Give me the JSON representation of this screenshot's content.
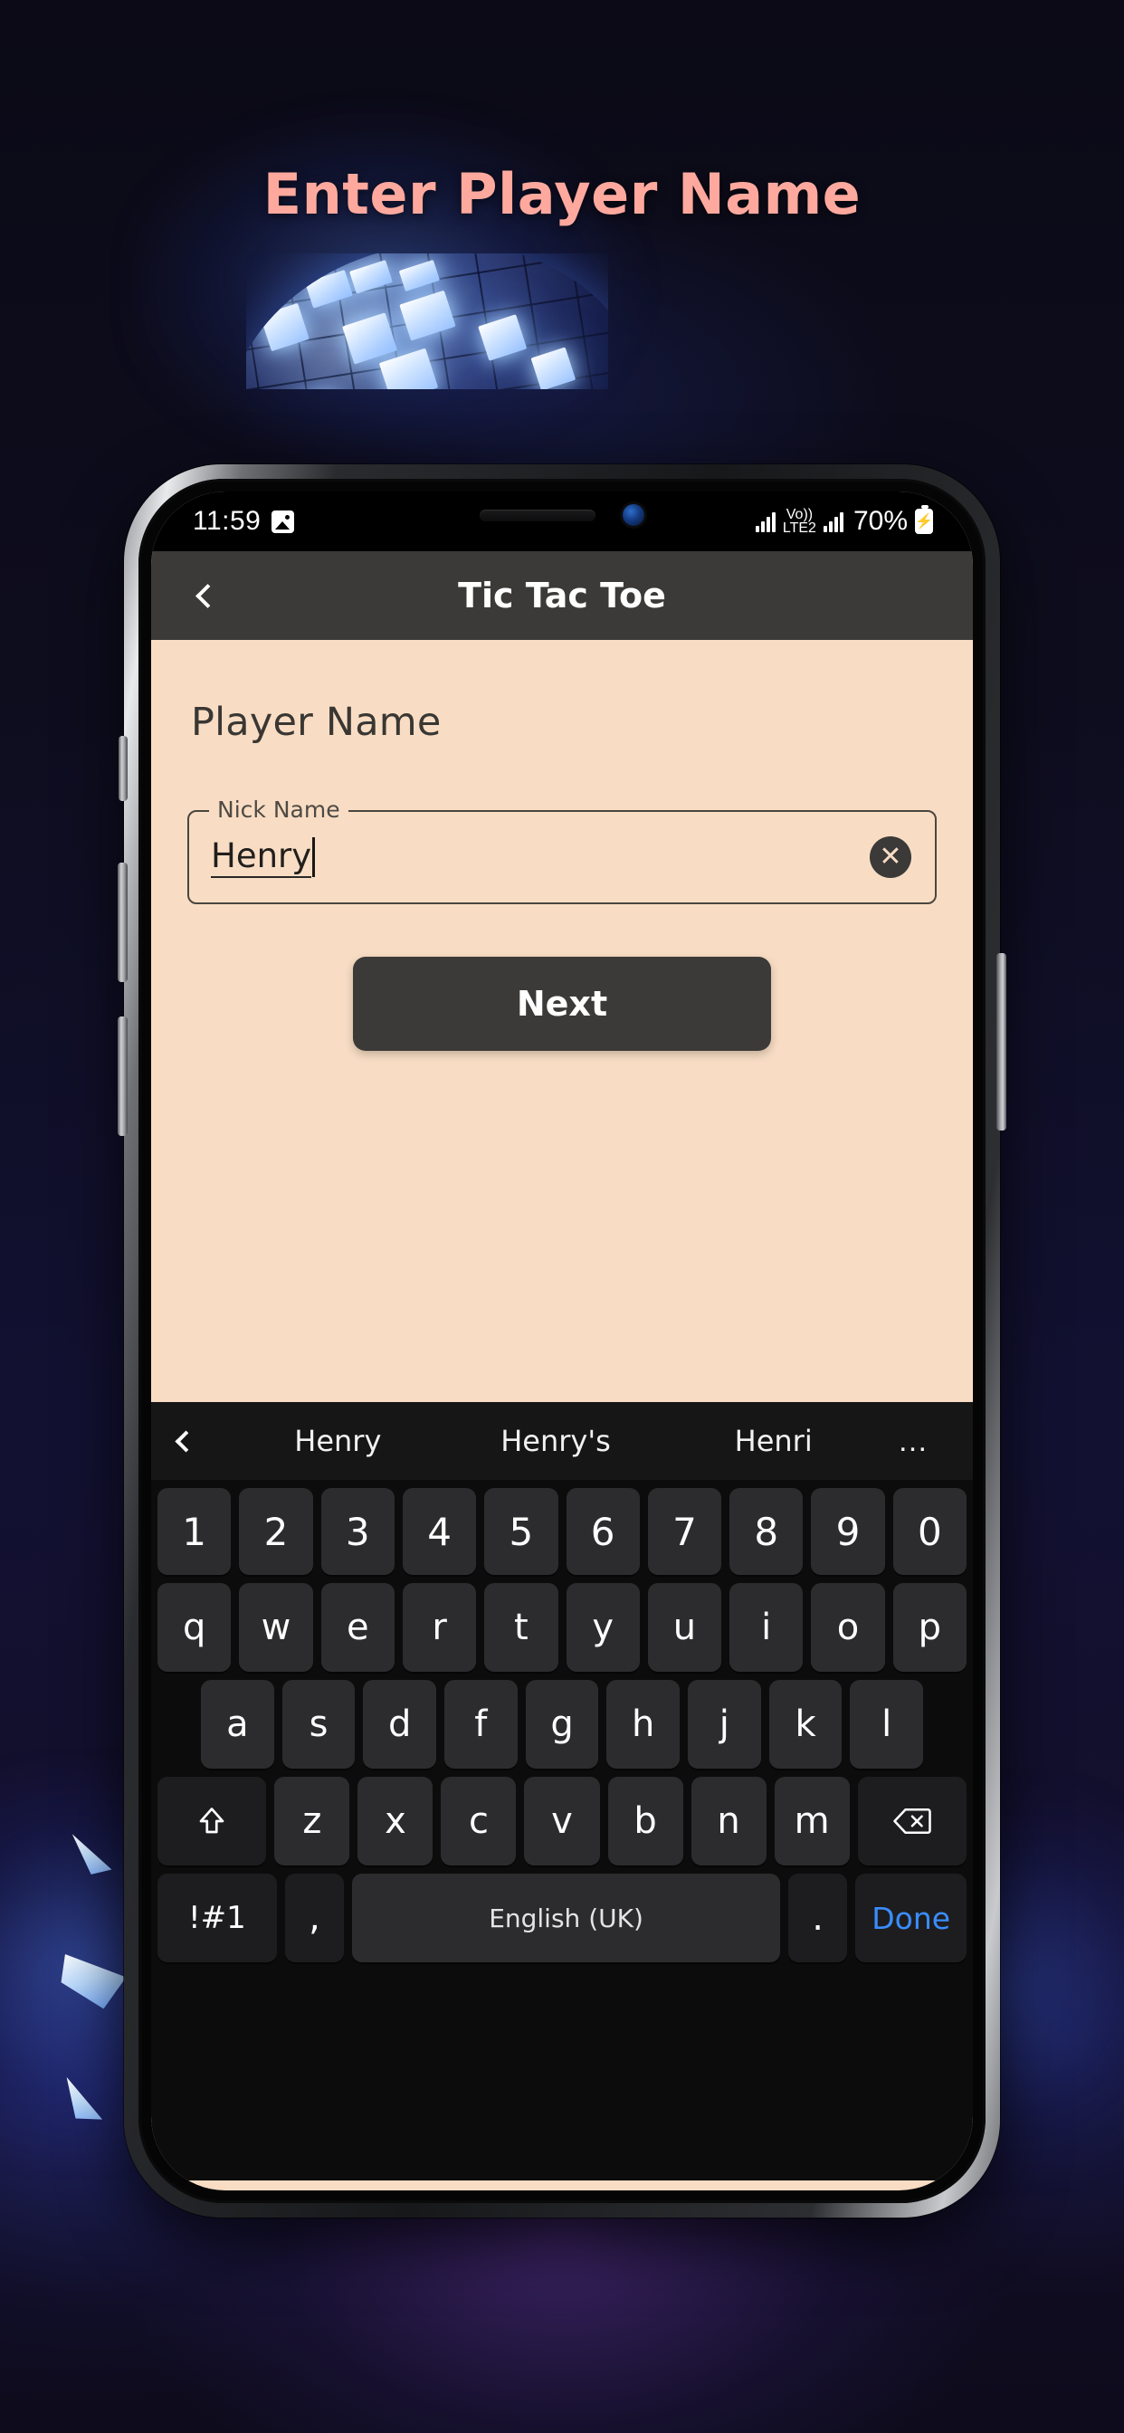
{
  "headline": "Enter Player Name",
  "phone": {
    "side_buttons": [
      "mute-switch",
      "volume-up",
      "volume-down",
      "power"
    ],
    "notch": [
      "speaker-grille",
      "front-camera"
    ]
  },
  "status_bar": {
    "time": "11:59",
    "left_icons": [
      "photo-icon"
    ],
    "network_label": "Vo))",
    "network_type": "LTE2",
    "battery_percent": "70%",
    "battery_state": "charging"
  },
  "app_bar": {
    "back_icon": "chevron-left-icon",
    "title": "Tic Tac Toe"
  },
  "content": {
    "page_title": "Player Name",
    "field": {
      "label": "Nick Name",
      "value": "Henry",
      "placeholder": "Nick Name",
      "clear_icon": "close-circle-icon"
    },
    "next_label": "Next"
  },
  "keyboard": {
    "language": "English (UK)",
    "suggestions": [
      "Henry",
      "Henry's",
      "Henri"
    ],
    "suggestion_back_icon": "chevron-left-icon",
    "suggestion_more": "…",
    "rows": {
      "numbers": [
        "1",
        "2",
        "3",
        "4",
        "5",
        "6",
        "7",
        "8",
        "9",
        "0"
      ],
      "top": [
        "q",
        "w",
        "e",
        "r",
        "t",
        "y",
        "u",
        "i",
        "o",
        "p"
      ],
      "home": [
        "a",
        "s",
        "d",
        "f",
        "g",
        "h",
        "j",
        "k",
        "l"
      ],
      "bottom": [
        "z",
        "x",
        "c",
        "v",
        "b",
        "n",
        "m"
      ]
    },
    "shift_icon": "shift-arrow-icon",
    "backspace_icon": "backspace-icon",
    "symbols_label": "!#1",
    "comma_label": ",",
    "period_label": ".",
    "done_label": "Done"
  },
  "colors": {
    "accent_headline": "#ffa99e",
    "content_bg": "#f8ddc4",
    "appbar_bg": "#3b3a38",
    "button_bg": "#3b3a38",
    "key_bg": "#2c2c2e",
    "done_blue": "#3a8dff"
  }
}
